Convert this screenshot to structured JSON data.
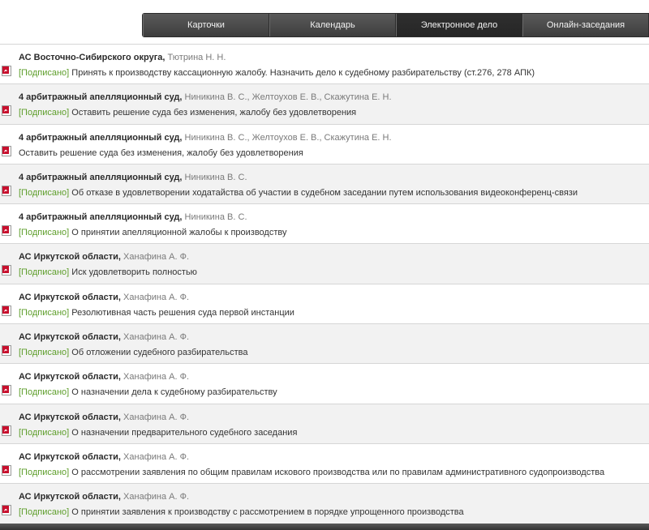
{
  "tabs": [
    {
      "label": "Карточки",
      "active": false
    },
    {
      "label": "Календарь",
      "active": false
    },
    {
      "label": "Электронное дело",
      "active": true
    },
    {
      "label": "Онлайн-заседания",
      "active": false
    }
  ],
  "documents": [
    {
      "court": "АС Восточно-Сибирского округа,",
      "judges": "Тютрина Н. Н.",
      "status": "[Подписано]",
      "text": "Принять к производству кассационную жалобу. Назначить дело к судебному разбирательству (ст.276, 278 АПК)",
      "icon": "pdf-icon"
    },
    {
      "court": "4 арбитражный апелляционный суд,",
      "judges": "Ниникина В. С., Желтоухов Е. В., Скажутина Е. Н.",
      "status": "[Подписано]",
      "text": "Оставить решение суда без изменения, жалобу без удовлетворения",
      "icon": "pdf-icon"
    },
    {
      "court": "4 арбитражный апелляционный суд,",
      "judges": "Ниникина В. С., Желтоухов Е. В., Скажутина Е. Н.",
      "status": "",
      "text": "Оставить решение суда без изменения, жалобу без удовлетворения",
      "icon": "pdf-icon"
    },
    {
      "court": "4 арбитражный апелляционный суд,",
      "judges": "Ниникина В. С.",
      "status": "[Подписано]",
      "text": "Об отказе в удовлетворении ходатайства об участии в судебном заседании путем использования видеоконференц-связи",
      "icon": "pdf-icon"
    },
    {
      "court": "4 арбитражный апелляционный суд,",
      "judges": "Ниникина В. С.",
      "status": "[Подписано]",
      "text": "О принятии апелляционной жалобы к производству",
      "icon": "pdf-icon"
    },
    {
      "court": "АС Иркутской области,",
      "judges": "Ханафина А. Ф.",
      "status": "[Подписано]",
      "text": "Иск удовлетворить полностью",
      "icon": "pdf-icon"
    },
    {
      "court": "АС Иркутской области,",
      "judges": "Ханафина А. Ф.",
      "status": "[Подписано]",
      "text": "Резолютивная часть решения суда первой инстанции",
      "icon": "pdf-icon"
    },
    {
      "court": "АС Иркутской области,",
      "judges": "Ханафина А. Ф.",
      "status": "[Подписано]",
      "text": "Об отложении судебного разбирательства",
      "icon": "pdf-icon"
    },
    {
      "court": "АС Иркутской области,",
      "judges": "Ханафина А. Ф.",
      "status": "[Подписано]",
      "text": "О назначении дела к судебному разбирательству",
      "icon": "pdf-icon"
    },
    {
      "court": "АС Иркутской области,",
      "judges": "Ханафина А. Ф.",
      "status": "[Подписано]",
      "text": "О назначении предварительного судебного заседания",
      "icon": "pdf-icon"
    },
    {
      "court": "АС Иркутской области,",
      "judges": "Ханафина А. Ф.",
      "status": "[Подписано]",
      "text": "О рассмотрении заявления по общим правилам искового производства или по правилам административного судопроизводства",
      "icon": "pdf-icon"
    },
    {
      "court": "АС Иркутской области,",
      "judges": "Ханафина А. Ф.",
      "status": "[Подписано]",
      "text": "О принятии заявления к производству с рассмотрением в порядке упрощенного производства",
      "icon": "pdf-icon"
    }
  ],
  "colors": {
    "signed": "#5e9e2b",
    "tab_bg": "#444444",
    "tab_active": "#2a2a2a",
    "row_alt": "#f2f2f2",
    "pdf_red": "#c8102e"
  }
}
